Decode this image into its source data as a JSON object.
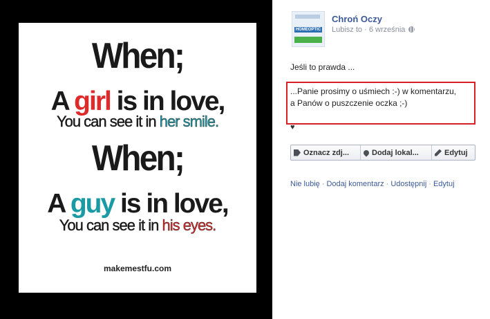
{
  "image_text": {
    "when1": "When;",
    "girl_line": {
      "a": "A ",
      "girl": "girl",
      "rest": " is in love,"
    },
    "girl_see": {
      "pre": "You can see it in ",
      "tail": "her smile."
    },
    "when2": "When;",
    "guy_line": {
      "a": "A ",
      "guy": "guy",
      "rest": " is in love,"
    },
    "guy_see": {
      "pre": "You can see it in ",
      "tail": "his eyes."
    },
    "credit": "makemestfu.com"
  },
  "post": {
    "page_name": "Chroń Oczy",
    "liked_status": "Lubisz to",
    "separator": "·",
    "date": "6 września",
    "avatar_text": "HOMEOPTIC",
    "line1": "Jeśli to prawda ...",
    "body_line1": "...Panie prosimy o uśmiech :-) w komentarzu,",
    "body_line2": "a Panów o puszczenie oczka ;-)",
    "heart": "♥"
  },
  "buttons": {
    "tag": "Oznacz zdj...",
    "location": "Dodaj lokal...",
    "edit": "Edytuj"
  },
  "actions": {
    "unlike": "Nie lubię",
    "comment": "Dodaj komentarz",
    "share": "Udostępnij",
    "edit": "Edytuj",
    "sep": "·"
  },
  "colors": {
    "link": "#3b5998",
    "highlight_border": "#d61f26",
    "accent_red": "#dd2b2b",
    "accent_teal": "#1a9aa5"
  }
}
